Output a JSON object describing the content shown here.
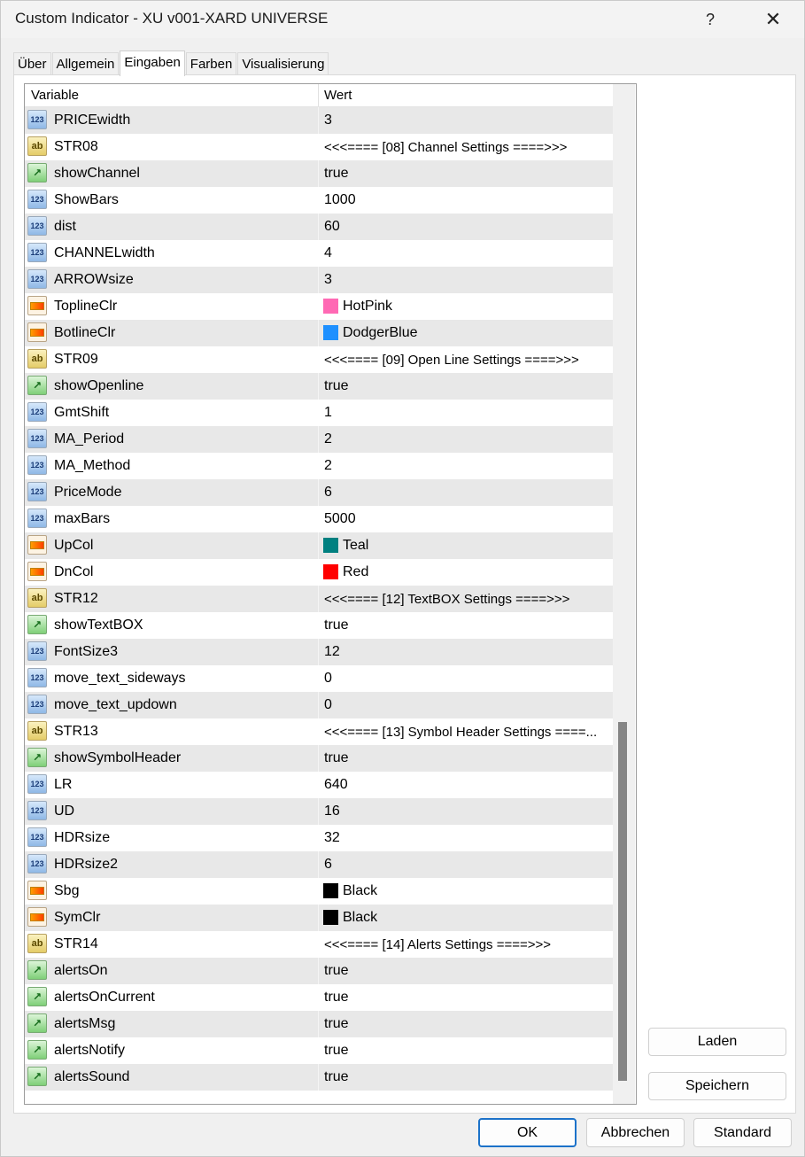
{
  "window": {
    "title": "Custom Indicator - XU v001-XARD UNIVERSE",
    "help_glyph": "?",
    "close_glyph": "✕"
  },
  "tabs": [
    {
      "label": "Über"
    },
    {
      "label": "Allgemein"
    },
    {
      "label": "Eingaben"
    },
    {
      "label": "Farben"
    },
    {
      "label": "Visualisierung"
    }
  ],
  "active_tab": "Eingaben",
  "grid": {
    "col_variable": "Variable",
    "col_value": "Wert",
    "rows": [
      {
        "type": "num",
        "name": "PRICEwidth",
        "value": "3"
      },
      {
        "type": "str",
        "name": "STR08",
        "value": "<<<==== [08] Channel Settings ====>>>"
      },
      {
        "type": "bool",
        "name": "showChannel",
        "value": "true"
      },
      {
        "type": "num",
        "name": "ShowBars",
        "value": "1000"
      },
      {
        "type": "num",
        "name": "dist",
        "value": "60"
      },
      {
        "type": "num",
        "name": "CHANNELwidth",
        "value": "4"
      },
      {
        "type": "num",
        "name": "ARROWsize",
        "value": "3"
      },
      {
        "type": "color",
        "name": "ToplineClr",
        "value": "HotPink",
        "swatch": "#ff69b4"
      },
      {
        "type": "color",
        "name": "BotlineClr",
        "value": "DodgerBlue",
        "swatch": "#1e90ff"
      },
      {
        "type": "str",
        "name": "STR09",
        "value": "<<<==== [09] Open Line Settings ====>>>"
      },
      {
        "type": "bool",
        "name": "showOpenline",
        "value": "true"
      },
      {
        "type": "num",
        "name": "GmtShift",
        "value": "1"
      },
      {
        "type": "num",
        "name": "MA_Period",
        "value": "2"
      },
      {
        "type": "num",
        "name": "MA_Method",
        "value": "2"
      },
      {
        "type": "num",
        "name": "PriceMode",
        "value": "6"
      },
      {
        "type": "num",
        "name": "maxBars",
        "value": "5000"
      },
      {
        "type": "color",
        "name": "UpCol",
        "value": "Teal",
        "swatch": "#008080"
      },
      {
        "type": "color",
        "name": "DnCol",
        "value": "Red",
        "swatch": "#ff0000"
      },
      {
        "type": "str",
        "name": "STR12",
        "value": "<<<==== [12] TextBOX Settings ====>>>"
      },
      {
        "type": "bool",
        "name": "showTextBOX",
        "value": "true"
      },
      {
        "type": "num",
        "name": "FontSize3",
        "value": "12"
      },
      {
        "type": "num",
        "name": "move_text_sideways",
        "value": "0"
      },
      {
        "type": "num",
        "name": "move_text_updown",
        "value": "0"
      },
      {
        "type": "str",
        "name": "STR13",
        "value": "<<<==== [13] Symbol Header Settings ====..."
      },
      {
        "type": "bool",
        "name": "showSymbolHeader",
        "value": "true"
      },
      {
        "type": "num",
        "name": "LR",
        "value": "640"
      },
      {
        "type": "num",
        "name": "UD",
        "value": "16"
      },
      {
        "type": "num",
        "name": "HDRsize",
        "value": "32"
      },
      {
        "type": "num",
        "name": "HDRsize2",
        "value": "6"
      },
      {
        "type": "color",
        "name": "Sbg",
        "value": "Black",
        "swatch": "#000000"
      },
      {
        "type": "color",
        "name": "SymClr",
        "value": "Black",
        "swatch": "#000000"
      },
      {
        "type": "str",
        "name": "STR14",
        "value": "<<<==== [14] Alerts Settings ====>>>"
      },
      {
        "type": "bool",
        "name": "alertsOn",
        "value": "true"
      },
      {
        "type": "bool",
        "name": "alertsOnCurrent",
        "value": "true"
      },
      {
        "type": "bool",
        "name": "alertsMsg",
        "value": "true"
      },
      {
        "type": "bool",
        "name": "alertsNotify",
        "value": "true"
      },
      {
        "type": "bool",
        "name": "alertsSound",
        "value": "true"
      }
    ]
  },
  "icons": {
    "num": "123",
    "str": "ab",
    "bool": "↗",
    "color": ""
  },
  "side_buttons": {
    "load": "Laden",
    "save": "Speichern"
  },
  "footer": {
    "ok": "OK",
    "cancel": "Abbrechen",
    "standard": "Standard"
  }
}
